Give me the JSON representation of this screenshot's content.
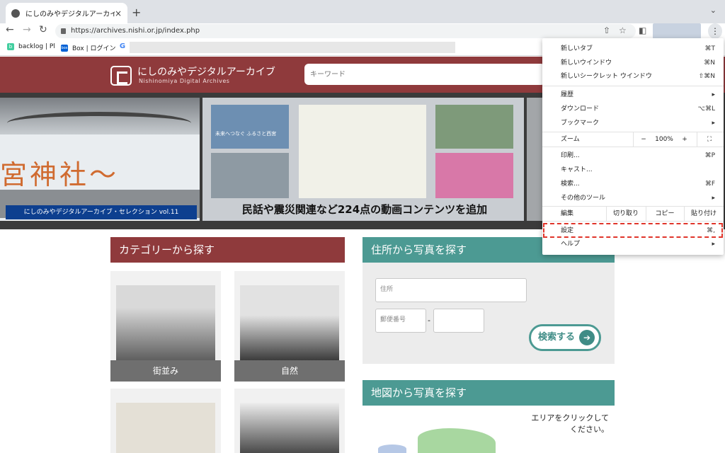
{
  "browser": {
    "tab_title": "にしのみやデジタルアーカイブ",
    "tab_close": "×",
    "new_tab": "+",
    "tab_menu": "⌄",
    "url": "https://archives.nishi.or.jp/index.php",
    "bookmarks": [
      {
        "label": "backlog | Pl",
        "color": "#42ce9f",
        "icon": "b"
      },
      {
        "label": "Box | ログイン",
        "color": "#0061d5",
        "icon": "box"
      },
      {
        "label": "",
        "color": "#ffffff",
        "icon": "G"
      }
    ]
  },
  "site": {
    "brand_ja": "にしのみやデジタルアーカイブ",
    "brand_en": "Nishinomiya Digital Archives",
    "search_placeholder": "キーワード"
  },
  "banner": {
    "left_text": "宮神社～",
    "left_caption": "にしのみやデジタルアーカイブ・セレクション vol.11",
    "mid_caption": "民話や震災関連など224点の動画コンテンツを追加",
    "mid_thumb_text": "未来へつなぐ ふるさと西宮"
  },
  "category": {
    "heading": "カテゴリーから探す",
    "cards": [
      {
        "label": "街並み"
      },
      {
        "label": "自然"
      },
      {
        "label": ""
      },
      {
        "label": ""
      }
    ]
  },
  "address": {
    "heading": "住所から写真を探す",
    "address_placeholder": "住所",
    "zip_placeholder": "郵便番号",
    "dash": "-",
    "search_button": "検索する",
    "arrow": "➔"
  },
  "map": {
    "heading": "地図から写真を探す",
    "hint_line1": "エリアをクリックして",
    "hint_line2": "ください。"
  },
  "menu": {
    "items": [
      {
        "label": "新しいタブ",
        "shortcut": "⌘T"
      },
      {
        "label": "新しいウインドウ",
        "shortcut": "⌘N"
      },
      {
        "label": "新しいシークレット ウインドウ",
        "shortcut": "⇧⌘N"
      },
      {
        "label": "履歴",
        "shortcut": "▸"
      },
      {
        "label": "ダウンロード",
        "shortcut": "⌥⌘L"
      },
      {
        "label": "ブックマーク",
        "shortcut": "▸"
      },
      {
        "label": "印刷...",
        "shortcut": "⌘P"
      },
      {
        "label": "キャスト...",
        "shortcut": ""
      },
      {
        "label": "検索...",
        "shortcut": "⌘F"
      },
      {
        "label": "その他のツール",
        "shortcut": "▸"
      },
      {
        "label": "設定",
        "shortcut": "⌘,"
      },
      {
        "label": "ヘルプ",
        "shortcut": "▸"
      }
    ],
    "zoom": {
      "label": "ズーム",
      "minus": "−",
      "value": "100%",
      "plus": "+",
      "fullscreen": "⛶"
    },
    "edit": {
      "label": "編集",
      "cut": "切り取り",
      "copy": "コピー",
      "paste": "貼り付け"
    }
  }
}
